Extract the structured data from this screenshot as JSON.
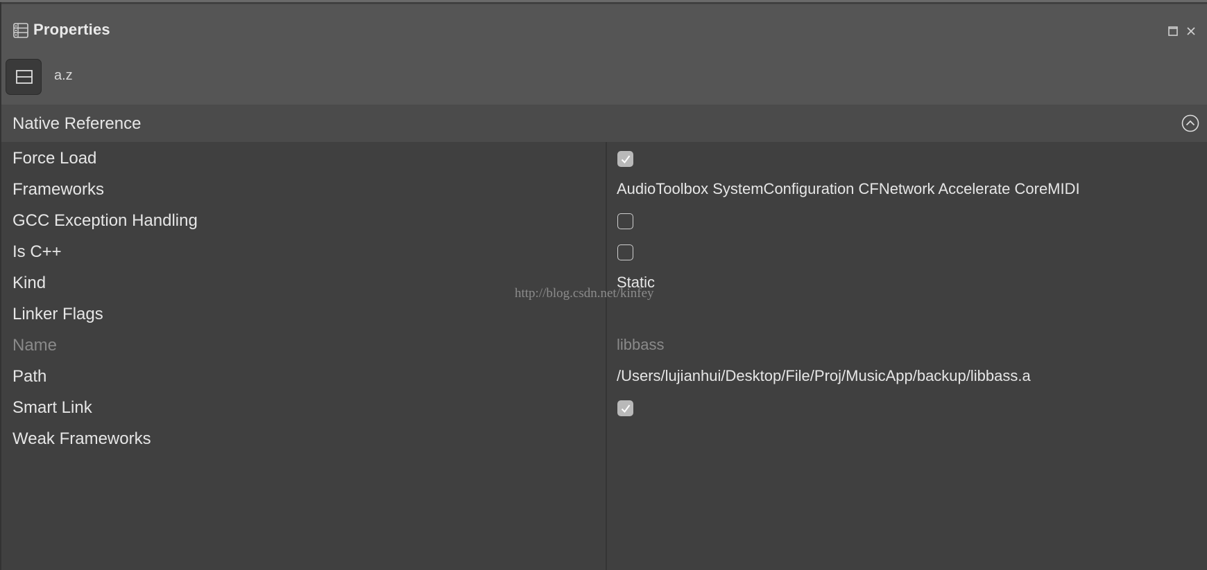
{
  "panel": {
    "title": "Properties",
    "title_icon": "properties-list-icon",
    "maximize_icon": "maximize-icon",
    "close_icon": "close-icon"
  },
  "toolbar": {
    "sort_by_category_icon": "categorized-view-icon",
    "sort_alpha_label": "a.z"
  },
  "section": {
    "title": "Native Reference",
    "collapse_icon": "chevron-up-circle-icon"
  },
  "properties": [
    {
      "name": "Force Load",
      "type": "checkbox",
      "checked": true
    },
    {
      "name": "Frameworks",
      "type": "text",
      "value": "AudioToolbox SystemConfiguration CFNetwork Accelerate CoreMIDI"
    },
    {
      "name": "GCC Exception Handling",
      "type": "checkbox",
      "checked": false
    },
    {
      "name": "Is C++",
      "type": "checkbox",
      "checked": false
    },
    {
      "name": "Kind",
      "type": "text",
      "value": "Static"
    },
    {
      "name": "Linker Flags",
      "type": "text",
      "value": ""
    },
    {
      "name": "Name",
      "type": "text",
      "value": "libbass",
      "disabled": true
    },
    {
      "name": "Path",
      "type": "text",
      "value": "/Users/lujianhui/Desktop/File/Proj/MusicApp/backup/libbass.a"
    },
    {
      "name": "Smart Link",
      "type": "checkbox",
      "checked": true
    },
    {
      "name": "Weak Frameworks",
      "type": "text",
      "value": ""
    }
  ],
  "watermark": "http://blog.csdn.net/kinfey",
  "colors": {
    "panel_bg": "#404040",
    "header_bg": "#555555",
    "section_bg": "#4b4b4b",
    "text": "#e6e6e6",
    "disabled_text": "#8a8a8a",
    "checkbox_checked": "#b9b9b9"
  }
}
